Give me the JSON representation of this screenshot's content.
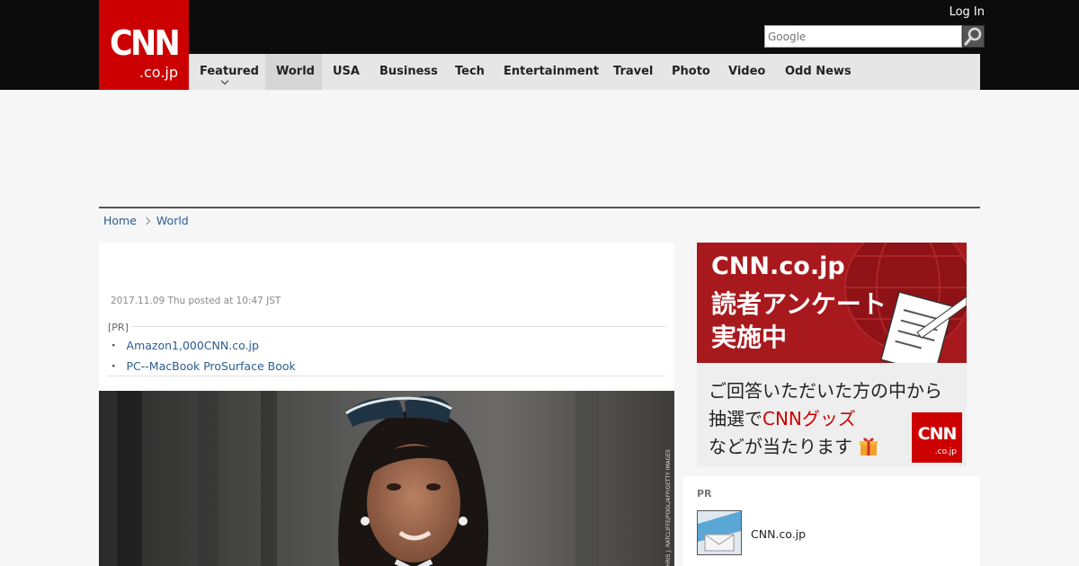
{
  "header": {
    "logo_text": "CNN",
    "logo_suffix": ".co.jp",
    "login_label": "Log In",
    "search_placeholder": "Google"
  },
  "nav": {
    "items": [
      {
        "label": "Featured"
      },
      {
        "label": "World"
      },
      {
        "label": "USA"
      },
      {
        "label": "Business"
      },
      {
        "label": "Tech"
      },
      {
        "label": "Entertainment"
      },
      {
        "label": "Travel"
      },
      {
        "label": "Photo"
      },
      {
        "label": "Video"
      },
      {
        "label": "Odd News"
      }
    ],
    "active": "World"
  },
  "breadcrumb": {
    "home": "Home",
    "current": "World"
  },
  "article": {
    "post_date": "2017.11.09 Thu posted at 10:47 JST",
    "pr_label": "[PR]",
    "pr_links": [
      "Amazon1,000CNN.co.jp",
      "PC--MacBook ProSurface Book"
    ],
    "photo_credit": "CHRIS J. RATCLIFFE/POOL/AFP/GETTY IMAGES"
  },
  "sidebar": {
    "banner": {
      "title_line1": "CNN.co.jp",
      "title_line2": "読者アンケート",
      "title_line3": "実施中",
      "body_line1": "ご回答いただいた方の中から",
      "body_line2_pre": "抽選で",
      "body_line2_red": "CNNグッズ",
      "body_line3": "などが当たります",
      "logo_text": "CNN",
      "logo_suffix": ".co.jp"
    },
    "pr_box": {
      "heading": "PR",
      "item_label": "CNN.co.jp"
    }
  },
  "colors": {
    "brand_red": "#cc0000",
    "header_bg": "#0c0c0c",
    "nav_bg": "#e6e6e6",
    "link": "#2a5d8f",
    "banner_red": "#a8191d"
  }
}
